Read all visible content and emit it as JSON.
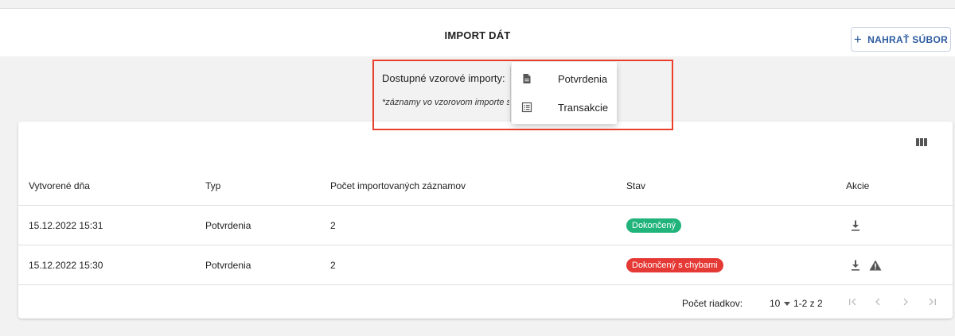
{
  "header": {
    "title": "IMPORT DÁT",
    "upload_button": {
      "icon": "plus-icon",
      "label": "NAHRAŤ SÚBOR"
    }
  },
  "samples": {
    "label": "Dostupné vzorové importy:",
    "note": "*záznamy vo vzorovom importe s",
    "menu": [
      {
        "icon": "document-icon",
        "label": "Potvrdenia"
      },
      {
        "icon": "list-icon",
        "label": "Transakcie"
      }
    ]
  },
  "table": {
    "toolbar_icon": "view-column-icon",
    "columns": [
      "Vytvorené dňa",
      "Typ",
      "Počet importovaných záznamov",
      "Stav",
      "Akcie"
    ],
    "rows": [
      {
        "created": "15.12.2022 15:31",
        "type": "Potvrdenia",
        "count": "2",
        "status": "Dokončený",
        "status_kind": "success",
        "actions": [
          "download-icon"
        ]
      },
      {
        "created": "15.12.2022 15:30",
        "type": "Potvrdenia",
        "count": "2",
        "status": "Dokončený s chybami",
        "status_kind": "error",
        "actions": [
          "download-icon",
          "warning-icon"
        ]
      }
    ],
    "pagination": {
      "rows_per_page_label": "Počet riadkov:",
      "rows_per_page": "10",
      "range": "1-2 z 2",
      "buttons": [
        "first-page-icon",
        "previous-page-icon",
        "next-page-icon",
        "last-page-icon"
      ]
    }
  },
  "colors": {
    "accent": "#2d5b9f",
    "success": "#20b37a",
    "error": "#e53935",
    "highlight": "#e8402a"
  }
}
